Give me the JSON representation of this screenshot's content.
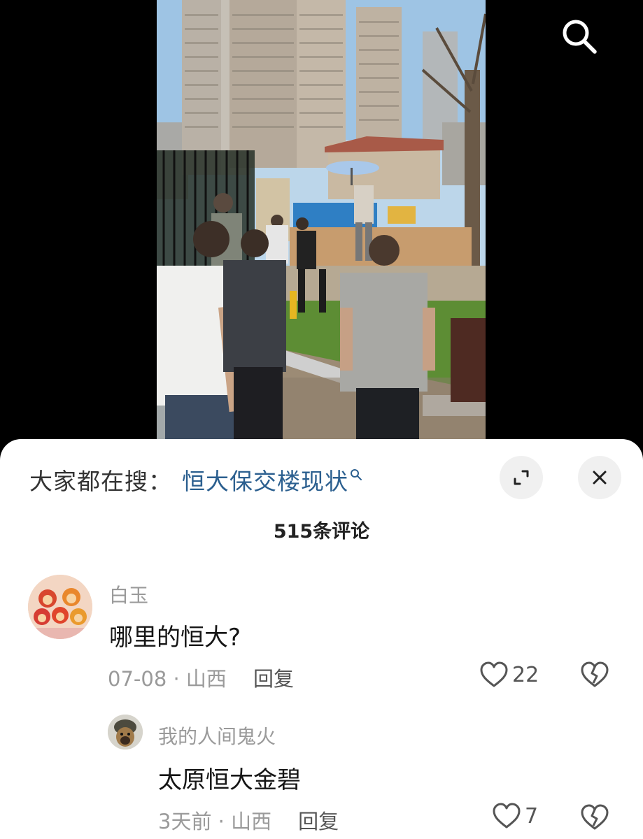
{
  "video": {
    "search_icon": "search-icon"
  },
  "search_bar": {
    "label": "大家都在搜：",
    "term": "恒大保交楼现状",
    "search_icon": "magnifier-icon",
    "expand_icon": "expand-icon",
    "close_icon": "close-icon"
  },
  "comments_header": {
    "count_text": "515条评论"
  },
  "comments": [
    {
      "user": "白玉",
      "text": "哪里的恒大?",
      "date_location": "07-08 · 山西",
      "reply_label": "回复",
      "likes": "22",
      "avatar_icon": "monkey-toys-avatar"
    },
    {
      "user": "我的人间鬼火",
      "text": "太原恒大金碧",
      "date_location": "3天前 · 山西",
      "reply_label": "回复",
      "likes": "7",
      "avatar_icon": "dog-helmet-avatar"
    }
  ],
  "colors": {
    "link_blue": "#2b5f8f",
    "meta_gray": "#9a9a9a",
    "button_bg": "#f0f0f0"
  }
}
